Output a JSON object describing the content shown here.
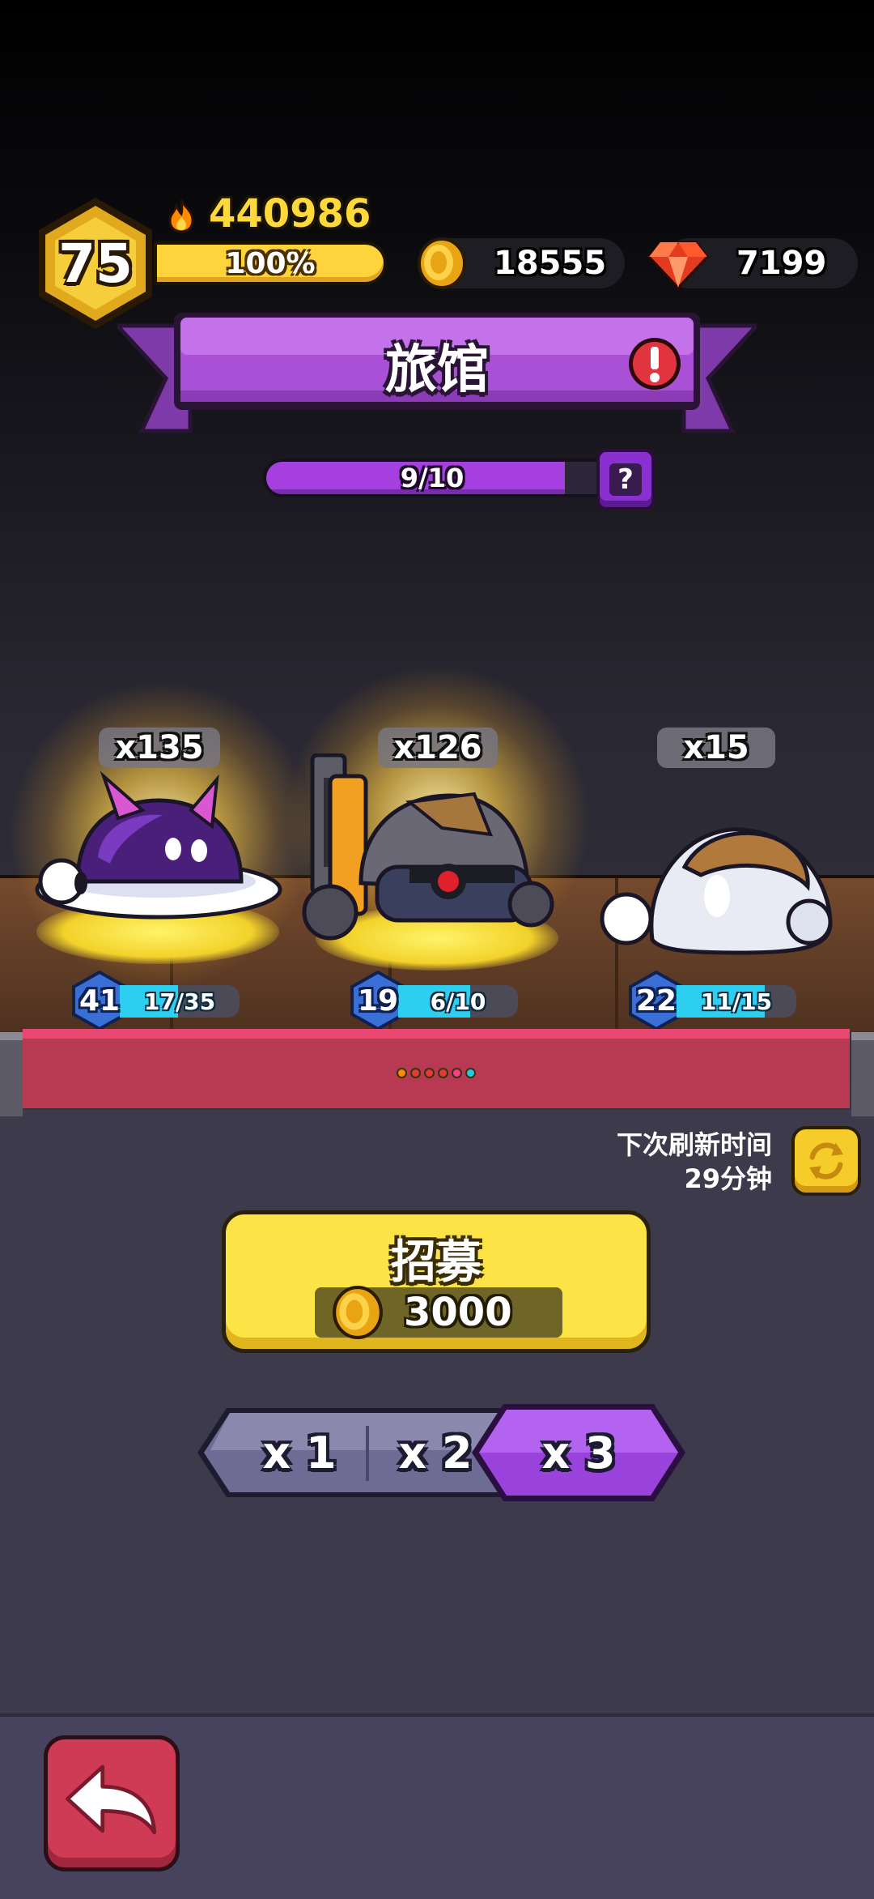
{
  "player": {
    "level": "75",
    "power": "440986",
    "xp_percent_label": "100%",
    "xp_fraction": 1.0
  },
  "currencies": {
    "gold": "18555",
    "gems": "7199"
  },
  "title": "旅馆",
  "recruit_progress": {
    "label": "9/10",
    "value": 9,
    "max": 10,
    "help_symbol": "?"
  },
  "heroes": [
    {
      "count": "x135",
      "level": "41",
      "progress": "17/35",
      "current": 17,
      "max": 35
    },
    {
      "count": "x126",
      "level": "19",
      "progress": "6/10",
      "current": 6,
      "max": 10
    },
    {
      "count": "x15",
      "level": "22",
      "progress": "11/15",
      "current": 11,
      "max": 15
    }
  ],
  "page_dots": [
    "#ff8a00",
    "#e53935",
    "#e53935",
    "#e53935",
    "#ff3b8a",
    "#29c7e6"
  ],
  "refresh": {
    "line1": "下次刷新时间",
    "line2": "29分钟"
  },
  "recruit": {
    "label": "招募",
    "cost": "3000"
  },
  "multipliers": [
    {
      "label": "x 1",
      "selected": false
    },
    {
      "label": "x 2",
      "selected": false
    },
    {
      "label": "x 3",
      "selected": true
    }
  ],
  "icons": {
    "power": "flame-icon",
    "gold": "coin-icon",
    "gems": "ruby-icon",
    "alert": "exclamation-icon",
    "refresh": "refresh-icon",
    "back": "back-arrow-icon"
  },
  "colors": {
    "gold": "#fde446",
    "purple": "#a53fe0",
    "back": "#cf3a55",
    "xp": "#2dcff0"
  }
}
